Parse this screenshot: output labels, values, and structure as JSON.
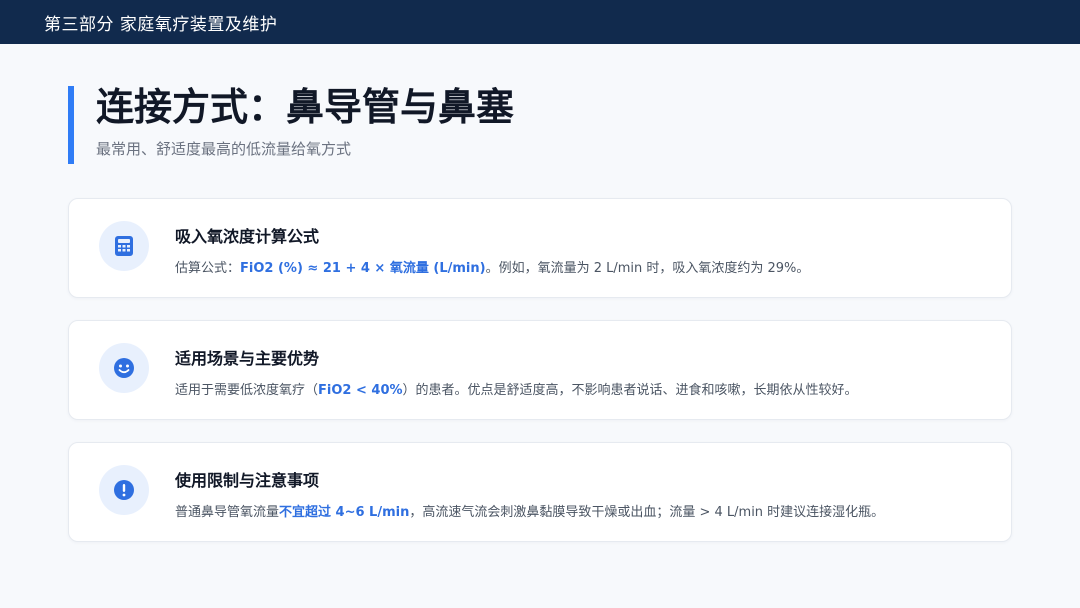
{
  "header": {
    "section_title": "第三部分 家庭氧疗装置及维护"
  },
  "page": {
    "title": "连接方式：鼻导管与鼻塞",
    "subtitle": "最常用、舒适度最高的低流量给氧方式"
  },
  "cards": [
    {
      "icon": "calculator-icon",
      "title": "吸入氧浓度计算公式",
      "desc_prefix": "估算公式：",
      "desc_highlight": "FiO2 (%) ≈ 21 + 4 × 氧流量 (L/min)",
      "desc_suffix": "。例如，氧流量为 2 L/min 时，吸入氧浓度约为 29%。"
    },
    {
      "icon": "smiley-icon",
      "title": "适用场景与主要优势",
      "desc_prefix": "适用于需要低浓度氧疗（",
      "desc_highlight": "FiO2 < 40%",
      "desc_suffix": "）的患者。优点是舒适度高，不影响患者说话、进食和咳嗽，长期依从性较好。"
    },
    {
      "icon": "exclamation-icon",
      "title": "使用限制与注意事项",
      "desc_prefix": "普通鼻导管氧流量",
      "desc_highlight": "不宜超过 4~6 L/min",
      "desc_suffix": "，高流速气流会刺激鼻黏膜导致干燥或出血；流量 > 4 L/min 时建议连接湿化瓶。"
    }
  ],
  "colors": {
    "header_bg": "#112a4d",
    "accent": "#2f7cf6",
    "highlight_text": "#2f6fe0",
    "icon_bg": "#e8f0fd"
  }
}
